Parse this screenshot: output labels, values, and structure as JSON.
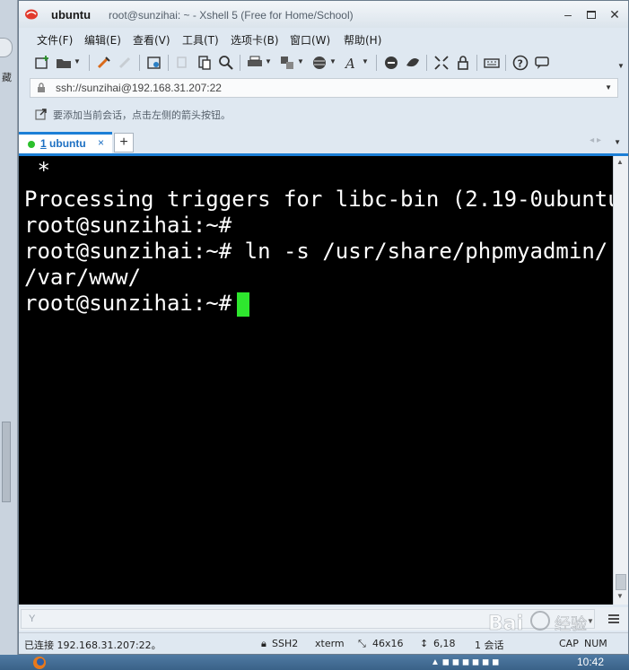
{
  "window": {
    "app_name": "ubuntu",
    "title": "root@sunzihai: ~ - Xshell 5 (Free for Home/School)",
    "min_symbol": "–",
    "close_symbol": "✕"
  },
  "background_window": {
    "fragment_text": "藏"
  },
  "menu": [
    "文件(F)",
    "编辑(E)",
    "查看(V)",
    "工具(T)",
    "选项卡(B)",
    "窗口(W)",
    "帮助(H)"
  ],
  "toolbar_icons": [
    "new-session-icon",
    "open-folder-icon",
    "reconnect-icon",
    "disconnect-icon",
    "properties-icon",
    "copy-icon",
    "paste-icon",
    "find-icon",
    "print-icon",
    "transfer-icon",
    "globe-icon",
    "font-icon",
    "xftp-icon",
    "xmanager-icon",
    "fullscreen-icon",
    "lock-icon",
    "keyboard-icon",
    "help-icon",
    "chat-icon"
  ],
  "address": {
    "value": "ssh://sunzihai@192.168.31.207:22"
  },
  "hint": {
    "text": "要添加当前会话，点击左侧的箭头按钮。"
  },
  "tabs": [
    {
      "label": "1 ubuntu",
      "number": "1",
      "name": "ubuntu",
      "close": "×",
      "active": true
    }
  ],
  "new_tab_symbol": "+",
  "tab_nav_symbol": "◂ ▸",
  "terminal": {
    "lines": [
      " *",
      "Processing triggers for libc-bin (2.19-0ubuntu",
      "root@sunzihai:~#",
      "root@sunzihai:~# ln -s /usr/share/phpmyadmin/",
      "/var/www/",
      "root@sunzihai:~# "
    ],
    "cursor_color": "#2ee62e"
  },
  "input": {
    "placeholder": "Y"
  },
  "status": {
    "connection": "已连接 192.168.31.207:22。",
    "protocol": "SSH2",
    "term": "xterm",
    "size": "46x16",
    "position": "6,18",
    "sessions": "1 会话",
    "caps": "CAP",
    "num": "NUM"
  },
  "taskbar": {
    "clock": "10:42"
  },
  "colors": {
    "accent": "#1c7fd6",
    "terminal_bg": "#000000",
    "terminal_fg": "#ffffff"
  }
}
